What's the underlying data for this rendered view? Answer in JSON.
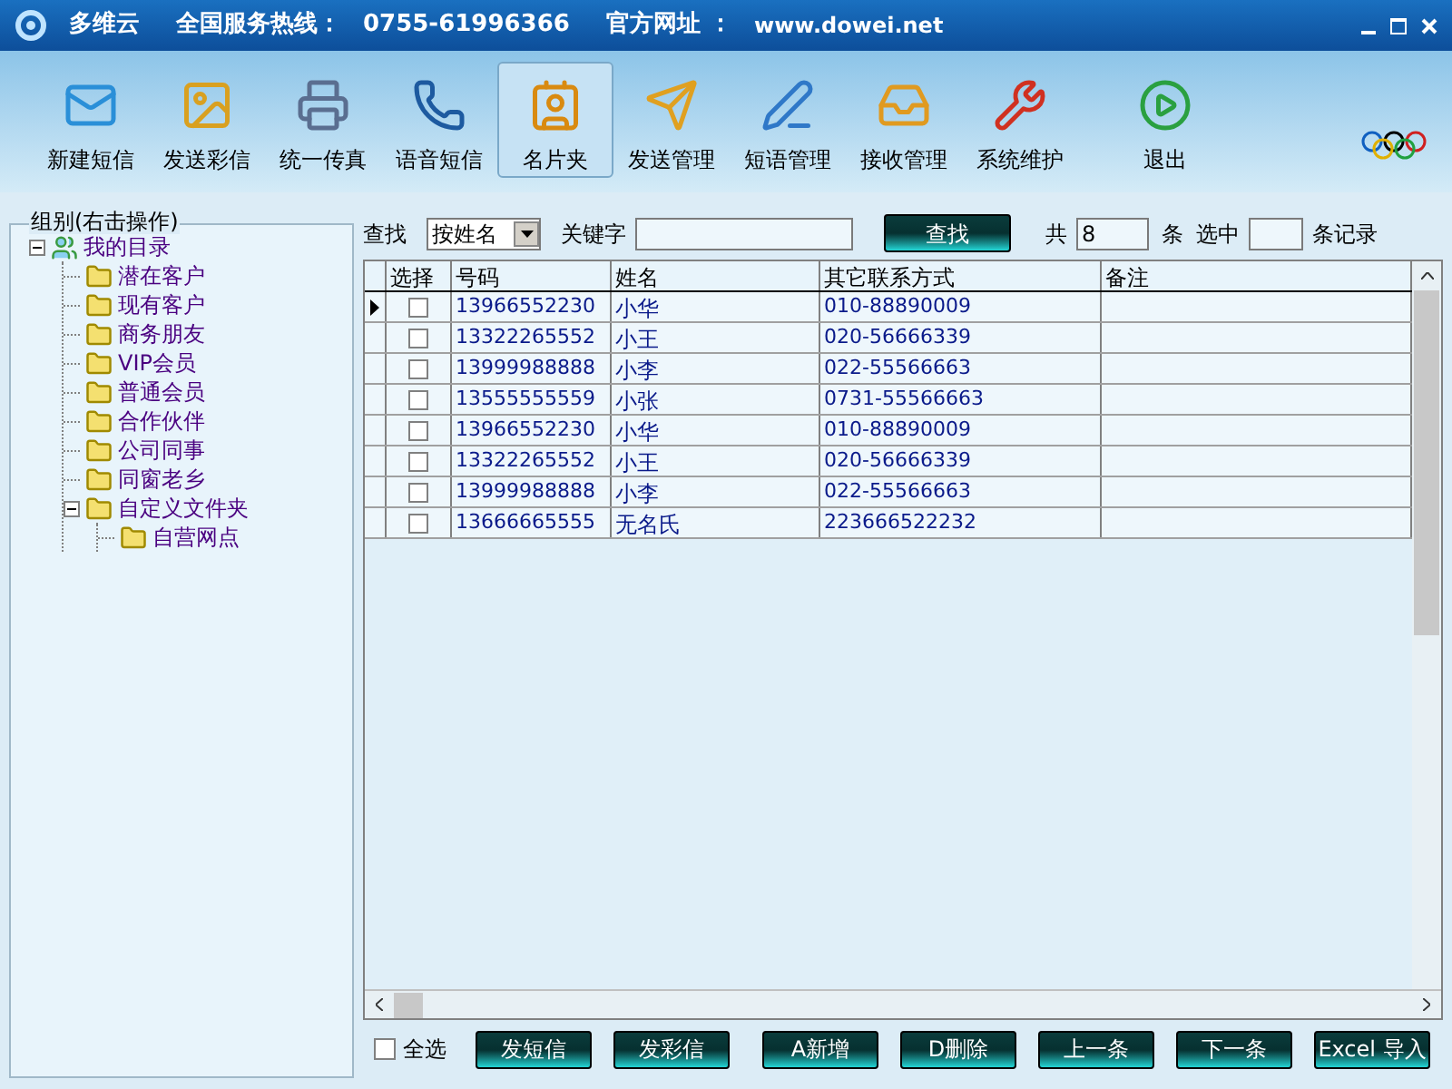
{
  "window": {
    "app_name": "多维云",
    "hotline_label": "全国服务热线：",
    "hotline": "0755-61996366",
    "site_label": "官方网址 ：",
    "site": "www.dowei.net"
  },
  "toolbar": [
    {
      "label": "新建短信",
      "selected": false
    },
    {
      "label": "发送彩信",
      "selected": false
    },
    {
      "label": "统一传真",
      "selected": false
    },
    {
      "label": "语音短信",
      "selected": false
    },
    {
      "label": "名片夹",
      "selected": true
    },
    {
      "label": "发送管理",
      "selected": false
    },
    {
      "label": "短语管理",
      "selected": false
    },
    {
      "label": "接收管理",
      "selected": false
    },
    {
      "label": "系统维护",
      "selected": false
    },
    {
      "label": "退出",
      "selected": false
    }
  ],
  "groups": {
    "title": "组别(右击操作)",
    "tree": [
      {
        "label": "我的目录",
        "kind": "contacts",
        "expanded": true,
        "children": [
          {
            "label": "潜在客户",
            "kind": "folder"
          },
          {
            "label": "现有客户",
            "kind": "folder"
          },
          {
            "label": "商务朋友",
            "kind": "folder"
          },
          {
            "label": "VIP会员",
            "kind": "folder"
          },
          {
            "label": "普通会员",
            "kind": "folder"
          },
          {
            "label": "合作伙伴",
            "kind": "folder"
          },
          {
            "label": "公司同事",
            "kind": "folder"
          },
          {
            "label": "同窗老乡",
            "kind": "folder"
          },
          {
            "label": "自定义文件夹",
            "kind": "folder",
            "expanded": true,
            "children": [
              {
                "label": "自营网点",
                "kind": "folder"
              }
            ]
          }
        ]
      }
    ]
  },
  "search": {
    "label": "查找",
    "mode": "按姓名",
    "keyword_label": "关键字",
    "button": "查找",
    "total_label": "共",
    "total": "8",
    "unit": "条",
    "selected_label": "选中",
    "selected_count_suffix": "条记录"
  },
  "table": {
    "columns": [
      "选择",
      "号码",
      "姓名",
      "其它联系方式",
      "备注"
    ],
    "rows": [
      {
        "current": true,
        "checked": false,
        "number": "13966552230",
        "name": "小华",
        "other": "010-88890009"
      },
      {
        "current": false,
        "checked": false,
        "number": "13322265552",
        "name": "小王",
        "other": "020-56666339"
      },
      {
        "current": false,
        "checked": false,
        "number": "13999988888",
        "name": "小李",
        "other": "022-55566663"
      },
      {
        "current": false,
        "checked": false,
        "number": "13555555559",
        "name": "小张",
        "other": "0731-55566663"
      },
      {
        "current": false,
        "checked": false,
        "number": "13966552230",
        "name": "小华",
        "other": "010-88890009"
      },
      {
        "current": false,
        "checked": false,
        "number": "13322265552",
        "name": "小王",
        "other": "020-56666339"
      },
      {
        "current": false,
        "checked": false,
        "number": "13999988888",
        "name": "小李",
        "other": "022-55566663"
      },
      {
        "current": false,
        "checked": false,
        "number": "13666665555",
        "name": "无名氏",
        "other": "223666522232"
      }
    ]
  },
  "footer": {
    "select_all": {
      "label": "全选",
      "checked": false
    },
    "buttons": [
      "发短信",
      "发彩信",
      "A新增",
      "D删除",
      "上一条",
      "下一条",
      "Excel 导入"
    ]
  }
}
